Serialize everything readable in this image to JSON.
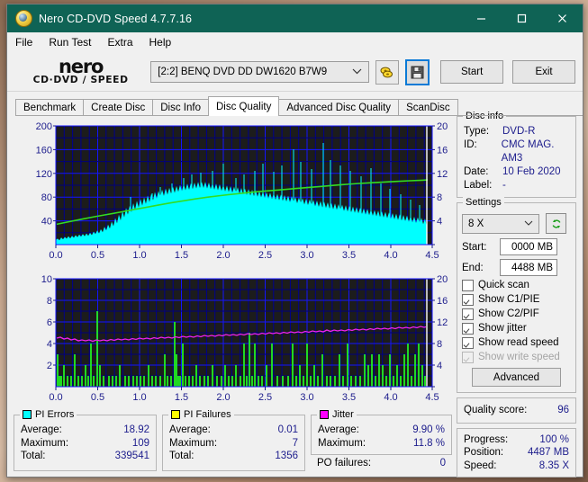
{
  "window": {
    "title": "Nero CD-DVD Speed 4.7.7.16",
    "app_icon": "nero-disc-icon",
    "minimize_label": "–",
    "maximize_label": "□",
    "close_label": "✕",
    "titlebar_color": "#0f6355"
  },
  "menubar": {
    "items": [
      {
        "label": "File"
      },
      {
        "label": "Run Test"
      },
      {
        "label": "Extra"
      },
      {
        "label": "Help"
      }
    ]
  },
  "toolbar": {
    "logo_word": "nero",
    "logo_sub": "CD·DVD ∕ SPEED",
    "drive": "[2:2]   BENQ DVD DD DW1620 B7W9",
    "eject_icon": "eject-disc-icon",
    "save_icon": "floppy-save-icon",
    "start_label": "Start",
    "exit_label": "Exit"
  },
  "tabs": [
    {
      "label": "Benchmark",
      "active": false
    },
    {
      "label": "Create Disc",
      "active": false
    },
    {
      "label": "Disc Info",
      "active": false
    },
    {
      "label": "Disc Quality",
      "active": true
    },
    {
      "label": "Advanced Disc Quality",
      "active": false
    },
    {
      "label": "ScanDisc",
      "active": false
    }
  ],
  "disc_info": {
    "title": "Disc info",
    "type_label": "Type:",
    "type_value": "DVD-R",
    "id_label": "ID:",
    "id_value": "CMC MAG. AM3",
    "date_label": "Date:",
    "date_value": "10 Feb 2020",
    "label_label": "Label:",
    "label_value": "-"
  },
  "settings": {
    "title": "Settings",
    "speed_value": "8 X",
    "refresh_icon": "refresh-icon",
    "start_label": "Start:",
    "start_value": "0000 MB",
    "end_label": "End:",
    "end_value": "4488 MB",
    "checks": [
      {
        "label": "Quick scan",
        "checked": false,
        "disabled": false
      },
      {
        "label": "Show C1/PIE",
        "checked": true,
        "disabled": false
      },
      {
        "label": "Show C2/PIF",
        "checked": true,
        "disabled": false
      },
      {
        "label": "Show jitter",
        "checked": true,
        "disabled": false
      },
      {
        "label": "Show read speed",
        "checked": true,
        "disabled": false
      },
      {
        "label": "Show write speed",
        "checked": true,
        "disabled": true
      }
    ],
    "advanced_label": "Advanced"
  },
  "quality": {
    "label": "Quality score:",
    "value": "96"
  },
  "progress": {
    "progress_label": "Progress:",
    "progress_value": "100 %",
    "position_label": "Position:",
    "position_value": "4487 MB",
    "speed_label": "Speed:",
    "speed_value": "8.35 X"
  },
  "pi_errors": {
    "title": "PI Errors",
    "swatch": "#00ffff",
    "average_label": "Average:",
    "average_value": "18.92",
    "maximum_label": "Maximum:",
    "maximum_value": "109",
    "total_label": "Total:",
    "total_value": "339541"
  },
  "pi_failures": {
    "title": "PI Failures",
    "swatch": "#ffff00",
    "average_label": "Average:",
    "average_value": "0.01",
    "maximum_label": "Maximum:",
    "maximum_value": "7",
    "total_label": "Total:",
    "total_value": "1356"
  },
  "jitter": {
    "title": "Jitter",
    "swatch": "#ff00ff",
    "average_label": "Average:",
    "average_value": "9.90 %",
    "maximum_label": "Maximum:",
    "maximum_value": "11.8 %",
    "po_label": "PO failures:",
    "po_value": "0"
  },
  "chart_data": [
    {
      "type": "area",
      "name": "pi-errors-chart",
      "title": "PI Errors / read speed",
      "background": "#1c1c1c",
      "grid_color": "#0000ff",
      "xlabel": "",
      "ylabel": "",
      "x": [
        0.0,
        4.5
      ],
      "xlim": [
        0.0,
        4.5
      ],
      "xticks": [
        0.0,
        0.5,
        1.0,
        1.5,
        2.0,
        2.5,
        3.0,
        3.5,
        4.0,
        4.5
      ],
      "xticklabels": [
        "0.0",
        "0.5",
        "1.0",
        "1.5",
        "2.0",
        "2.5",
        "3.0",
        "3.5",
        "4.0",
        "4.5"
      ],
      "ylim": [
        0,
        200
      ],
      "yticks": [
        40,
        80,
        120,
        160,
        200
      ],
      "yticklabels": [
        "40",
        "80",
        "120",
        "160",
        "200"
      ],
      "y2lim": [
        0,
        20
      ],
      "y2ticks": [
        4,
        8,
        12,
        16,
        20
      ],
      "y2ticklabels": [
        "4",
        "8",
        "12",
        "16",
        "20"
      ],
      "data_end_x": 4.37,
      "series": [
        {
          "name": "PI Errors",
          "color": "#00ffff",
          "axis": "left",
          "style": "spiky-area",
          "baseline": [
            8,
            9,
            10,
            10,
            11,
            11,
            12,
            12,
            12,
            13,
            13,
            14,
            14,
            15,
            16,
            17,
            19,
            21,
            24,
            27,
            30,
            33,
            36,
            38,
            40,
            42,
            44,
            46,
            48,
            50,
            52,
            54,
            56,
            58,
            60,
            62,
            63,
            64,
            65,
            65,
            64,
            63,
            62,
            60,
            58,
            55,
            52,
            48,
            44,
            40,
            36,
            32,
            29,
            27,
            25
          ],
          "spike_max": 109
        },
        {
          "name": "Read speed",
          "color": "#33dd22",
          "axis": "right",
          "style": "line",
          "values": [
            3.5,
            3.8,
            4.0,
            4.1,
            4.2,
            4.3,
            4.4,
            4.5,
            4.6,
            4.7,
            4.8,
            4.9,
            5.0,
            5.1,
            5.2,
            5.3,
            5.4,
            5.5,
            5.6,
            5.7,
            5.8,
            5.9,
            6.0,
            6.1,
            6.2,
            6.3,
            6.4,
            6.5,
            6.6,
            6.7,
            6.8,
            6.9,
            7.0,
            7.05,
            7.1,
            7.2,
            7.3,
            7.4,
            7.5,
            7.55,
            7.6,
            7.65,
            7.7,
            7.75,
            7.8,
            7.85,
            7.9,
            7.95,
            8.0,
            8.05,
            8.1,
            8.15,
            8.2,
            8.25,
            8.3
          ]
        }
      ]
    },
    {
      "type": "bar",
      "name": "pi-failures-chart",
      "title": "PI Failures / jitter",
      "background": "#1c1c1c",
      "grid_color": "#0000ff",
      "xlabel": "",
      "ylabel": "",
      "xlim": [
        0.0,
        4.5
      ],
      "xticks": [
        0.0,
        0.5,
        1.0,
        1.5,
        2.0,
        2.5,
        3.0,
        3.5,
        4.0,
        4.5
      ],
      "xticklabels": [
        "0.0",
        "0.5",
        "1.0",
        "1.5",
        "2.0",
        "2.5",
        "3.0",
        "3.5",
        "4.0",
        "4.5"
      ],
      "ylim": [
        0,
        10
      ],
      "yticks": [
        2,
        4,
        6,
        8,
        10
      ],
      "yticklabels": [
        "2",
        "4",
        "6",
        "8",
        "10"
      ],
      "y2lim": [
        0,
        20
      ],
      "y2ticks": [
        4,
        8,
        12,
        16,
        20
      ],
      "y2ticklabels": [
        "4",
        "8",
        "12",
        "16",
        "20"
      ],
      "data_end_x": 4.37,
      "series": [
        {
          "name": "PI Failures",
          "color": "#22ee22",
          "axis": "left",
          "style": "sparse-bars",
          "max_value": 7,
          "typical_value": 1
        },
        {
          "name": "Jitter",
          "color": "#ee22ee",
          "axis": "right",
          "style": "line",
          "values": [
            9.0,
            9.1,
            8.9,
            9.0,
            8.8,
            8.7,
            8.8,
            8.9,
            9.0,
            8.9,
            9.0,
            9.1,
            9.0,
            9.1,
            9.2,
            9.2,
            9.3,
            9.3,
            9.4,
            9.5,
            9.6,
            9.5,
            9.6,
            9.7,
            9.6,
            9.7,
            9.8,
            9.8,
            9.9,
            10.0,
            9.9,
            10.0,
            10.1,
            10.2,
            10.2,
            10.3,
            10.4,
            10.3,
            10.5,
            10.6,
            10.6,
            10.7,
            10.8,
            10.8,
            10.9,
            11.0,
            11.1,
            11.1,
            11.2,
            11.3,
            11.3,
            11.4,
            11.4,
            11.5,
            11.4
          ]
        }
      ]
    }
  ]
}
